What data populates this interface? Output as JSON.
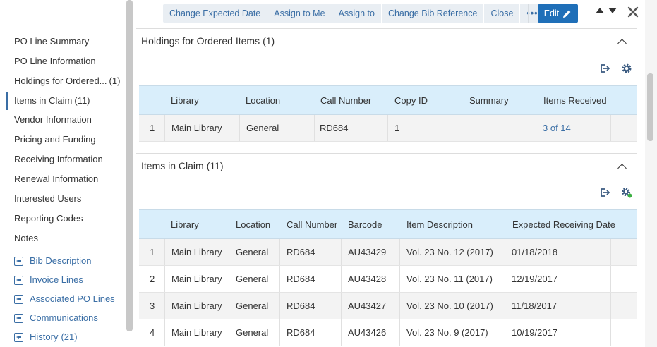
{
  "left_nav": {
    "items": [
      {
        "label": "PO Line Summary",
        "count": ""
      },
      {
        "label": "PO Line Information",
        "count": ""
      },
      {
        "label": "Holdings for Ordered...",
        "count": "(1)"
      },
      {
        "label": "Items in Claim",
        "count": "(11)"
      },
      {
        "label": "Vendor Information",
        "count": ""
      },
      {
        "label": "Pricing and Funding",
        "count": ""
      },
      {
        "label": "Receiving Information",
        "count": ""
      },
      {
        "label": "Renewal Information",
        "count": ""
      },
      {
        "label": "Interested Users",
        "count": ""
      },
      {
        "label": "Reporting Codes",
        "count": ""
      },
      {
        "label": "Notes",
        "count": ""
      }
    ],
    "active_index": 3,
    "links": [
      {
        "label": "Bib Description",
        "count": ""
      },
      {
        "label": "Invoice Lines",
        "count": ""
      },
      {
        "label": "Associated PO Lines",
        "count": ""
      },
      {
        "label": "Communications",
        "count": ""
      },
      {
        "label": "History",
        "count": "(21)"
      }
    ],
    "link_icon": "back-to-list-icon"
  },
  "toolbar": {
    "buttons": [
      "Change Expected Date",
      "Assign to Me",
      "Assign to",
      "Change Bib Reference",
      "Close"
    ],
    "more_label": "•••",
    "edit_label": "Edit",
    "edit_icon": "pencil-icon"
  },
  "holdings": {
    "title": "Holdings for Ordered Items",
    "count": "(1)",
    "columns": [
      "Library",
      "Location",
      "Call Number",
      "Copy ID",
      "Summary",
      "Items Received"
    ],
    "rows": [
      {
        "num": "1",
        "library": "Main Library",
        "location": "General",
        "call_number": "RD684",
        "copy_id": "1",
        "summary": "",
        "items_received": "3 of 14"
      }
    ]
  },
  "claim": {
    "title": "Items in Claim",
    "count": "(11)",
    "columns": [
      "Library",
      "Location",
      "Call Number",
      "Barcode",
      "Item Description",
      "Expected Receiving Date"
    ],
    "rows": [
      {
        "num": "1",
        "library": "Main Library",
        "location": "General",
        "call_number": "RD684",
        "barcode": "AU43429",
        "description": "Vol. 23 No. 12 (2017)",
        "date": "01/18/2018"
      },
      {
        "num": "2",
        "library": "Main Library",
        "location": "General",
        "call_number": "RD684",
        "barcode": "AU43428",
        "description": "Vol. 23 No. 11 (2017)",
        "date": "12/19/2017"
      },
      {
        "num": "3",
        "library": "Main Library",
        "location": "General",
        "call_number": "RD684",
        "barcode": "AU43427",
        "description": "Vol. 23 No. 10 (2017)",
        "date": "11/18/2017"
      },
      {
        "num": "4",
        "library": "Main Library",
        "location": "General",
        "call_number": "RD684",
        "barcode": "AU43426",
        "description": "Vol. 23 No. 9 (2017)",
        "date": "10/19/2017"
      }
    ]
  },
  "colors": {
    "accent": "#1f6fb8",
    "link": "#3a6ea5",
    "table_header": "#d9eefb",
    "status_dot": "#3cb043"
  }
}
